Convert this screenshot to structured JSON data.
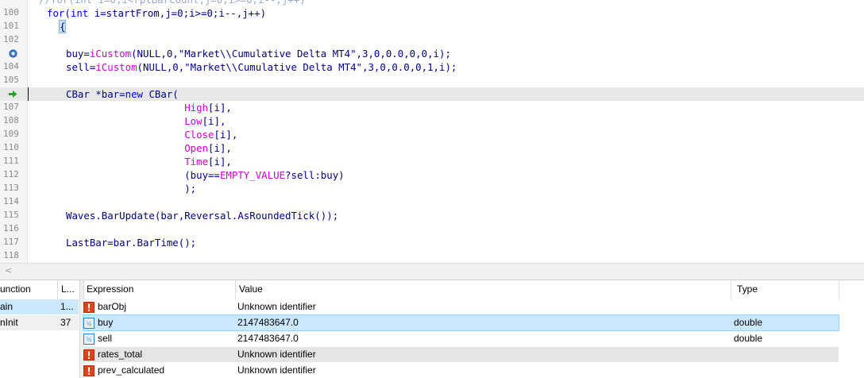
{
  "editor": {
    "partial_top_line": "//for(int i=0;i<rptBarCount;j=0;i>=0;i--,j++)",
    "lines": [
      {
        "num": "100",
        "tokens": [
          {
            "t": "for",
            "c": "kw"
          },
          {
            "t": "(",
            "c": ""
          },
          {
            "t": "int",
            "c": "kw"
          },
          {
            "t": " i=startFrom,j=0;i>=0;i--,j++)",
            "c": ""
          }
        ]
      },
      {
        "num": "101",
        "tokens": [
          {
            "t": "{",
            "c": "brace-hl"
          }
        ]
      },
      {
        "num": "102",
        "tokens": []
      },
      {
        "num": "103",
        "tokens": [
          {
            "t": "buy=",
            "c": ""
          },
          {
            "t": "iCustom",
            "c": "fn"
          },
          {
            "t": "(NULL,0,",
            "c": ""
          },
          {
            "t": "\"Market\\\\Cumulative Delta MT4\"",
            "c": "str"
          },
          {
            "t": ",3,0,0.0,0,0,i);",
            "c": ""
          }
        ],
        "marker": "breakpoint"
      },
      {
        "num": "104",
        "tokens": [
          {
            "t": "sell=",
            "c": ""
          },
          {
            "t": "iCustom",
            "c": "fn"
          },
          {
            "t": "(NULL,0,",
            "c": ""
          },
          {
            "t": "\"Market\\\\Cumulative Delta MT4\"",
            "c": "str"
          },
          {
            "t": ",3,0,0.0,0,1,i);",
            "c": ""
          }
        ]
      },
      {
        "num": "105",
        "tokens": []
      },
      {
        "num": "106",
        "tokens": [
          {
            "t": "CBar *bar=",
            "c": ""
          },
          {
            "t": "new",
            "c": "kw"
          },
          {
            "t": " CBar(",
            "c": ""
          }
        ],
        "marker": "arrow",
        "current": true
      },
      {
        "num": "107",
        "tokens": [
          {
            "t": "                    ",
            "c": ""
          },
          {
            "t": "High",
            "c": "fn"
          },
          {
            "t": "[i],",
            "c": ""
          }
        ]
      },
      {
        "num": "108",
        "tokens": [
          {
            "t": "                    ",
            "c": ""
          },
          {
            "t": "Low",
            "c": "fn"
          },
          {
            "t": "[i],",
            "c": ""
          }
        ]
      },
      {
        "num": "109",
        "tokens": [
          {
            "t": "                    ",
            "c": ""
          },
          {
            "t": "Close",
            "c": "fn"
          },
          {
            "t": "[i],",
            "c": ""
          }
        ]
      },
      {
        "num": "110",
        "tokens": [
          {
            "t": "                    ",
            "c": ""
          },
          {
            "t": "Open",
            "c": "fn"
          },
          {
            "t": "[i],",
            "c": ""
          }
        ]
      },
      {
        "num": "111",
        "tokens": [
          {
            "t": "                    ",
            "c": ""
          },
          {
            "t": "Time",
            "c": "fn"
          },
          {
            "t": "[i],",
            "c": ""
          }
        ]
      },
      {
        "num": "112",
        "tokens": [
          {
            "t": "                    (buy==",
            "c": ""
          },
          {
            "t": "EMPTY_VALUE",
            "c": "fn"
          },
          {
            "t": "?sell:buy)",
            "c": ""
          }
        ]
      },
      {
        "num": "113",
        "tokens": [
          {
            "t": "                    );",
            "c": ""
          }
        ]
      },
      {
        "num": "114",
        "tokens": []
      },
      {
        "num": "115",
        "tokens": [
          {
            "t": "Waves.BarUpdate(bar,Reversal.AsRoundedTick());",
            "c": ""
          }
        ]
      },
      {
        "num": "116",
        "tokens": []
      },
      {
        "num": "117",
        "tokens": [
          {
            "t": "LastBar=bar.BarTime();",
            "c": ""
          }
        ]
      },
      {
        "num": "118",
        "tokens": []
      }
    ],
    "scroll_left_arrow": "<"
  },
  "callstack": {
    "headers": {
      "function": "unction",
      "line": "L..."
    },
    "rows": [
      {
        "function": "ain",
        "line": "1...",
        "selected": true
      },
      {
        "function": "nInit",
        "line": "37",
        "selected": false
      }
    ]
  },
  "watch": {
    "headers": {
      "expression": "Expression",
      "value": "Value",
      "type": "Type"
    },
    "rows": [
      {
        "icon": "error-icon",
        "name": "barObj",
        "value": "Unknown identifier",
        "type": "",
        "style": "plain"
      },
      {
        "icon": "variable-icon",
        "name": "buy",
        "value": "2147483647.0",
        "type": "double",
        "style": "selected"
      },
      {
        "icon": "variable-icon",
        "name": "sell",
        "value": "2147483647.0",
        "type": "double",
        "style": "plain"
      },
      {
        "icon": "error-icon",
        "name": "rates_total",
        "value": "Unknown identifier",
        "type": "",
        "style": "grey"
      },
      {
        "icon": "error-icon",
        "name": "prev_calculated",
        "value": "Unknown identifier",
        "type": "",
        "style": "plain"
      }
    ]
  },
  "colors": {
    "keyword": "#0000ff",
    "function": "#d000d0",
    "code": "#000080",
    "selected_row": "#cce8ff",
    "grey_row": "#e5e5e5",
    "error_icon": "#e0431c",
    "variable_icon": "#2f7fd0"
  }
}
